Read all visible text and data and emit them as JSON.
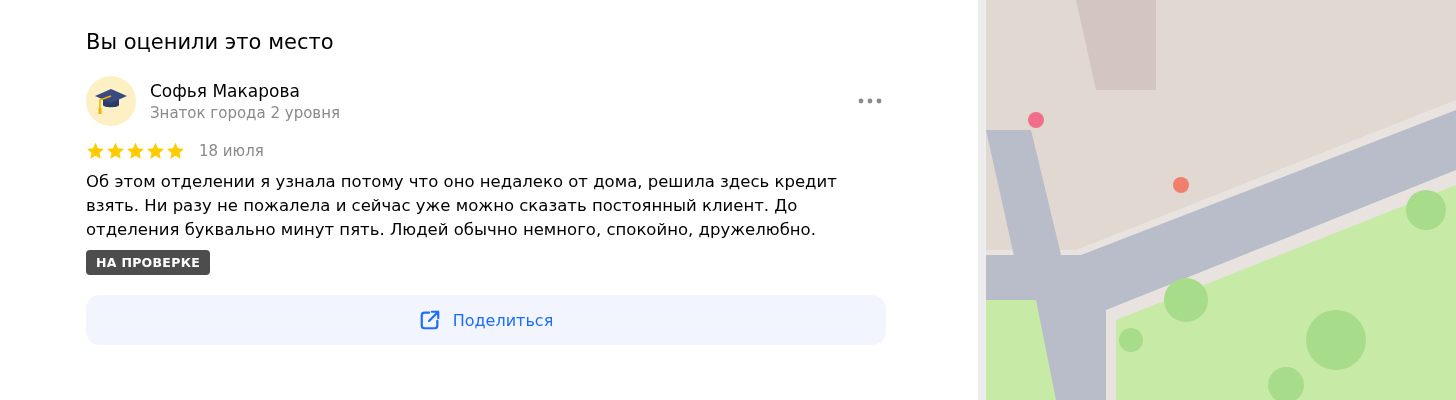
{
  "heading": "Вы оценили это место",
  "review": {
    "author": "Софья Макарова",
    "level": "Знаток города 2 уровня",
    "stars": 5,
    "date": "18 июля",
    "text": "Об этом отделении я узнала потому что оно недалеко от дома, решила здесь кредит взять. Ни разу не пожалела и сейчас уже можно сказать постоянный клиент. До отделения буквально минут пять. Людей обычно немного, спокойно, дружелюбно.",
    "status": "НА ПРОВЕРКЕ"
  },
  "share_button": "Поделиться"
}
